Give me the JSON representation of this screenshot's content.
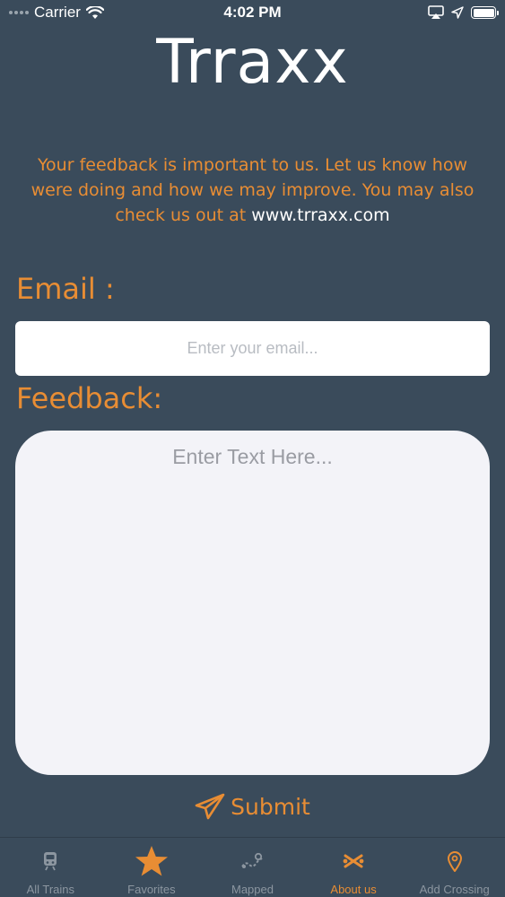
{
  "status_bar": {
    "carrier": "Carrier",
    "time": "4:02 PM",
    "battery_level": 1.0
  },
  "app": {
    "title": "Trraxx"
  },
  "intro": {
    "text": "Your feedback is important to us. Let us know how were doing and how we may improve. You may also check us out at ",
    "link": "www.trraxx.com"
  },
  "form": {
    "email_label": "Email :",
    "email_placeholder": "Enter your email...",
    "email_value": "",
    "feedback_label": "Feedback:",
    "feedback_placeholder": "Enter Text Here...",
    "feedback_value": "",
    "submit_label": "Submit"
  },
  "tabs": [
    {
      "label": "All Trains",
      "icon": "train-icon",
      "active": false
    },
    {
      "label": "Favorites",
      "icon": "star-icon",
      "active": false
    },
    {
      "label": "Mapped",
      "icon": "map-route-icon",
      "active": false
    },
    {
      "label": "About us",
      "icon": "railroad-crossing-icon",
      "active": true
    },
    {
      "label": "Add Crossing",
      "icon": "location-pin-icon",
      "active": false
    }
  ],
  "colors": {
    "background": "#3a4b5b",
    "accent": "#e88d34",
    "inactive_tab": "#8c96a0"
  }
}
